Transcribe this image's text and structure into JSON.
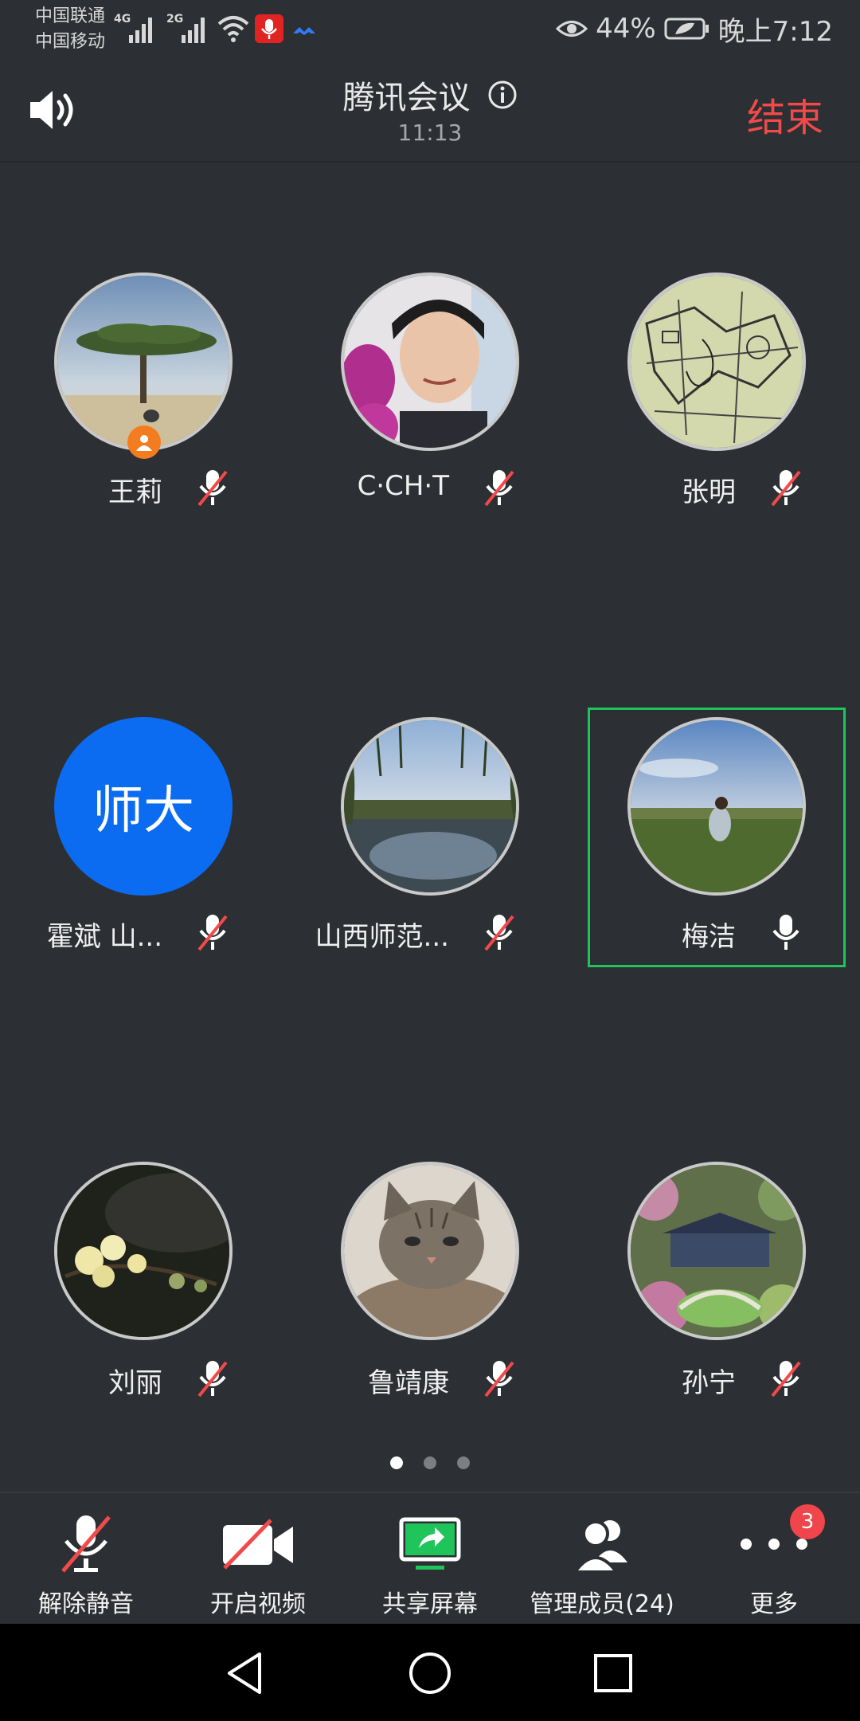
{
  "status_bar": {
    "carrier_1": "中国联通",
    "carrier_2": "中国移动",
    "net_1": "4G",
    "net_2": "2G",
    "battery": "44%",
    "time": "晚上7:12"
  },
  "header": {
    "title": "腾讯会议",
    "timer": "11:13",
    "end_label": "结束"
  },
  "participants": [
    {
      "name": "王莉",
      "muted": true,
      "host": true,
      "avatar": "tree-photo"
    },
    {
      "name": "C·CH·T",
      "muted": true,
      "avatar": "selfie-photo"
    },
    {
      "name": "张明",
      "muted": true,
      "avatar": "map-drawing"
    },
    {
      "name": "霍斌  山...",
      "muted": true,
      "avatar_text": "师大"
    },
    {
      "name": "山西师范...",
      "muted": true,
      "avatar": "lake-photo"
    },
    {
      "name": "梅洁",
      "muted": false,
      "active": true,
      "avatar": "grassland-photo"
    },
    {
      "name": "刘丽",
      "muted": true,
      "avatar": "flower-photo"
    },
    {
      "name": "鲁靖康",
      "muted": true,
      "avatar": "cat-photo"
    },
    {
      "name": "孙宁",
      "muted": true,
      "avatar": "garden-photo"
    }
  ],
  "pagination": {
    "pages": 3,
    "current": 1
  },
  "toolbar": {
    "unmute_label": "解除静音",
    "video_label": "开启视频",
    "share_label": "共享屏幕",
    "members_label": "管理成员(24)",
    "more_label": "更多",
    "more_badge": "3"
  },
  "colors": {
    "background": "#2c2f33",
    "end": "#f24a4a",
    "active_border": "#1fc45a",
    "share_accent": "#1fc45a",
    "text_avatar": "#0b6cf2",
    "host_badge": "#f47c20",
    "notice_badge": "#f0454a"
  }
}
